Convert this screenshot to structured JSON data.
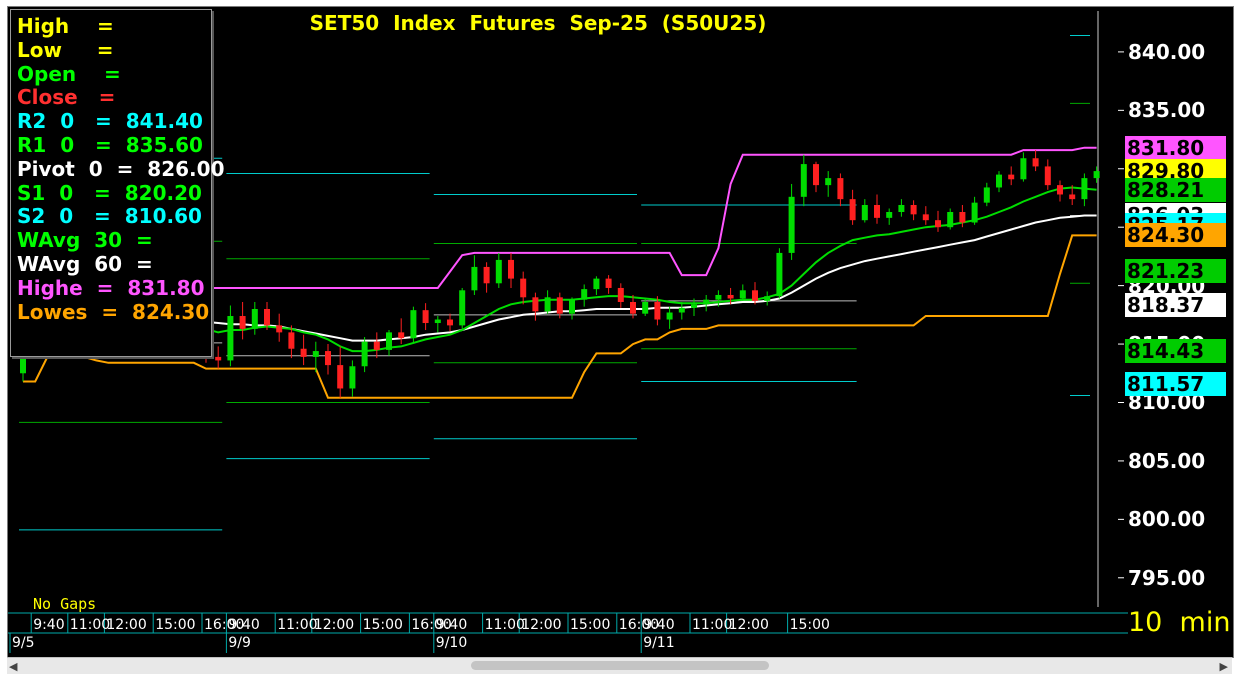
{
  "title": "SET50  Index  Futures  Sep-25  (S50U25)",
  "legend": [
    {
      "label": "High    =",
      "color": "#ffff00"
    },
    {
      "label": "Low     =",
      "color": "#ffff00"
    },
    {
      "label": "Open    =",
      "color": "#00ff00"
    },
    {
      "label": "Close   =",
      "color": "#ff3030"
    },
    {
      "label": "R2  0   =  841.40",
      "color": "#00ffff"
    },
    {
      "label": "R1  0   =  835.60",
      "color": "#00ff00"
    },
    {
      "label": "Pivot  0  =  826.00",
      "color": "#ffffff"
    },
    {
      "label": "S1  0   =  820.20",
      "color": "#00ff00"
    },
    {
      "label": "S2  0   =  810.60",
      "color": "#00ffff"
    },
    {
      "label": "WAvg  30  =",
      "color": "#00ff00"
    },
    {
      "label": "WAvg  60  =",
      "color": "#ffffff"
    },
    {
      "label": "Highe  =  831.80",
      "color": "#ff55ff"
    },
    {
      "label": "Lowes  =  824.30",
      "color": "#ffa500"
    }
  ],
  "no_gaps_label": "No Gaps",
  "interval_label": "10  min",
  "value_tags": [
    {
      "value": "831.80",
      "bg": "#ff55ff",
      "fg": "#000000"
    },
    {
      "value": "829.80",
      "bg": "#ffff00",
      "fg": "#000000"
    },
    {
      "value": "828.21",
      "bg": "#00cc00",
      "fg": "#000000"
    },
    {
      "value": "826.03",
      "bg": "#ffffff",
      "fg": "#000000"
    },
    {
      "value": "825.17",
      "bg": "#00ffff",
      "fg": "#000000"
    },
    {
      "value": "824.30",
      "bg": "#ffa500",
      "fg": "#000000"
    },
    {
      "value": "821.23",
      "bg": "#00cc00",
      "fg": "#000000"
    },
    {
      "value": "818.37",
      "bg": "#ffffff",
      "fg": "#000000"
    },
    {
      "value": "814.43",
      "bg": "#00cc00",
      "fg": "#000000"
    },
    {
      "value": "811.57",
      "bg": "#00ffff",
      "fg": "#000000"
    }
  ],
  "colors": {
    "background": "#000000",
    "bull": "#00dd00",
    "bear": "#ff2020",
    "highest": "#ff55ff",
    "lowest": "#ffa500",
    "wavg30": "#00dd00",
    "wavg60": "#ffffff",
    "pivot_r2": "#00cccc",
    "pivot_r1": "#00aa00",
    "pivot_s1": "#00aa00",
    "pivot_s2": "#00cccc",
    "time_axis": "#00aaaa"
  },
  "chart_data": {
    "type": "candlestick",
    "title": "SET50  Index  Futures  Sep-25  (S50U25)",
    "interval": "10  min",
    "ylim": [
      792.5,
      843.5
    ],
    "yticks": [
      "840.00",
      "835.00",
      "830.00",
      "825.00",
      "820.00",
      "815.00",
      "810.00",
      "805.00",
      "800.00",
      "795.00"
    ],
    "time_ticks": [
      {
        "bar": 1,
        "label": "9:40"
      },
      {
        "bar": 4,
        "label": "11:00"
      },
      {
        "bar": 7,
        "label": "12:00"
      },
      {
        "bar": 11,
        "label": "15:00"
      },
      {
        "bar": 15,
        "label": "16:00"
      },
      {
        "bar": 17,
        "label": "9:40"
      },
      {
        "bar": 21,
        "label": "11:00"
      },
      {
        "bar": 24,
        "label": "12:00"
      },
      {
        "bar": 28,
        "label": "15:00"
      },
      {
        "bar": 32,
        "label": "16:00"
      },
      {
        "bar": 34,
        "label": "9:40"
      },
      {
        "bar": 38,
        "label": "11:00"
      },
      {
        "bar": 41,
        "label": "12:00"
      },
      {
        "bar": 45,
        "label": "15:00"
      },
      {
        "bar": 49,
        "label": "16:00"
      },
      {
        "bar": 51,
        "label": "9:40"
      },
      {
        "bar": 55,
        "label": "11:00"
      },
      {
        "bar": 58,
        "label": "12:00"
      },
      {
        "bar": 63,
        "label": "15:00"
      }
    ],
    "dates": [
      {
        "bar": 0,
        "label": "9/5"
      },
      {
        "bar": 17,
        "label": "9/9"
      },
      {
        "bar": 34,
        "label": "9/10"
      },
      {
        "bar": 51,
        "label": "9/11"
      }
    ],
    "candles": [
      [
        812.5,
        815.2,
        811.8,
        814.6
      ],
      [
        814.6,
        816.0,
        813.9,
        815.4
      ],
      [
        815.4,
        817.0,
        814.8,
        816.2
      ],
      [
        816.2,
        818.6,
        815.6,
        818.0
      ],
      [
        818.0,
        818.8,
        816.5,
        817.1
      ],
      [
        817.1,
        818.0,
        815.8,
        816.4
      ],
      [
        816.4,
        817.8,
        815.2,
        817.2
      ],
      [
        817.2,
        818.5,
        816.3,
        817.6
      ],
      [
        817.6,
        818.4,
        816.4,
        816.9
      ],
      [
        816.9,
        817.7,
        815.3,
        815.8
      ],
      [
        815.8,
        817.0,
        814.6,
        816.5
      ],
      [
        816.5,
        817.8,
        815.8,
        817.1
      ],
      [
        817.1,
        817.5,
        815.4,
        815.8
      ],
      [
        815.8,
        816.6,
        814.2,
        814.8
      ],
      [
        814.8,
        816.2,
        814.0,
        815.6
      ],
      [
        815.6,
        816.0,
        813.4,
        813.9
      ],
      [
        813.9,
        814.8,
        812.9,
        813.6
      ],
      [
        813.6,
        818.3,
        813.1,
        817.4
      ],
      [
        817.4,
        818.6,
        815.4,
        816.3
      ],
      [
        816.3,
        818.6,
        815.8,
        818.0
      ],
      [
        818.0,
        818.6,
        816.2,
        816.6
      ],
      [
        816.6,
        817.6,
        815.2,
        816.0
      ],
      [
        816.0,
        816.6,
        813.8,
        814.6
      ],
      [
        814.6,
        815.8,
        813.2,
        813.9
      ],
      [
        813.9,
        815.2,
        812.6,
        814.4
      ],
      [
        814.4,
        815.0,
        812.4,
        813.2
      ],
      [
        813.2,
        814.8,
        810.4,
        811.2
      ],
      [
        811.2,
        813.6,
        810.5,
        813.1
      ],
      [
        813.1,
        815.6,
        812.6,
        815.2
      ],
      [
        815.2,
        816.0,
        813.8,
        814.5
      ],
      [
        814.5,
        816.2,
        814.0,
        816.0
      ],
      [
        816.0,
        817.2,
        815.0,
        815.5
      ],
      [
        815.5,
        818.2,
        815.1,
        817.9
      ],
      [
        817.9,
        818.5,
        816.2,
        816.8
      ],
      [
        816.8,
        817.4,
        816.0,
        817.1
      ],
      [
        817.1,
        817.6,
        816.1,
        816.6
      ],
      [
        816.6,
        819.8,
        816.2,
        819.6
      ],
      [
        819.6,
        822.6,
        819.2,
        821.6
      ],
      [
        821.6,
        822.0,
        819.4,
        820.2
      ],
      [
        820.2,
        822.8,
        819.8,
        822.2
      ],
      [
        822.2,
        822.8,
        819.8,
        820.6
      ],
      [
        820.6,
        821.2,
        818.4,
        819.0
      ],
      [
        819.0,
        819.4,
        817.0,
        817.8
      ],
      [
        817.8,
        819.6,
        817.6,
        819.0
      ],
      [
        819.0,
        819.4,
        817.2,
        817.6
      ],
      [
        817.6,
        819.0,
        817.1,
        818.8
      ],
      [
        818.8,
        820.1,
        818.2,
        819.7
      ],
      [
        819.7,
        820.8,
        819.2,
        820.6
      ],
      [
        820.6,
        820.9,
        819.3,
        819.8
      ],
      [
        819.8,
        820.2,
        818.1,
        818.6
      ],
      [
        818.6,
        819.2,
        817.2,
        817.6
      ],
      [
        817.6,
        818.9,
        817.4,
        818.6
      ],
      [
        818.6,
        819.1,
        816.6,
        817.1
      ],
      [
        817.1,
        818.2,
        816.3,
        817.7
      ],
      [
        817.7,
        818.6,
        817.1,
        818.1
      ],
      [
        818.1,
        818.9,
        817.4,
        818.4
      ],
      [
        818.4,
        819.2,
        817.8,
        818.8
      ],
      [
        818.8,
        819.6,
        818.2,
        819.2
      ],
      [
        819.2,
        819.8,
        818.4,
        818.9
      ],
      [
        818.9,
        820.1,
        818.7,
        819.6
      ],
      [
        819.6,
        820.3,
        818.4,
        818.7
      ],
      [
        818.7,
        819.5,
        818.3,
        819.1
      ],
      [
        819.1,
        823.2,
        818.9,
        822.8
      ],
      [
        822.8,
        828.7,
        822.2,
        827.6
      ],
      [
        827.6,
        831.2,
        826.8,
        830.4
      ],
      [
        830.4,
        830.6,
        828.0,
        828.6
      ],
      [
        828.6,
        829.8,
        827.6,
        829.2
      ],
      [
        829.2,
        829.6,
        826.8,
        827.4
      ],
      [
        827.4,
        828.2,
        825.2,
        825.6
      ],
      [
        825.6,
        827.4,
        825.4,
        826.9
      ],
      [
        826.9,
        827.8,
        825.3,
        825.8
      ],
      [
        825.8,
        826.6,
        825.2,
        826.3
      ],
      [
        826.3,
        827.4,
        825.9,
        826.9
      ],
      [
        826.9,
        827.3,
        825.6,
        826.1
      ],
      [
        826.1,
        826.8,
        825.2,
        825.6
      ],
      [
        825.6,
        826.4,
        824.6,
        825.0
      ],
      [
        825.0,
        826.6,
        824.8,
        826.3
      ],
      [
        826.3,
        826.9,
        825.0,
        825.4
      ],
      [
        825.4,
        827.6,
        825.2,
        827.1
      ],
      [
        827.1,
        828.8,
        826.8,
        828.4
      ],
      [
        828.4,
        829.8,
        828.0,
        829.5
      ],
      [
        829.5,
        830.2,
        828.6,
        829.1
      ],
      [
        829.1,
        831.4,
        828.9,
        830.9
      ],
      [
        830.9,
        831.6,
        829.8,
        830.2
      ],
      [
        830.2,
        830.8,
        828.2,
        828.6
      ],
      [
        828.6,
        829.0,
        827.2,
        827.8
      ],
      [
        827.8,
        828.6,
        826.9,
        827.4
      ],
      [
        827.4,
        829.6,
        826.8,
        829.2
      ],
      [
        829.2,
        830.2,
        828.8,
        829.8
      ]
    ],
    "highest": {
      "values": [
        824.0,
        824.0,
        824.0,
        824.0,
        824.0,
        824.0,
        824.0,
        824.0,
        824.0,
        824.0,
        824.0,
        824.0,
        822.8,
        820.4,
        819.8,
        819.8,
        819.8,
        819.8,
        819.8,
        819.8,
        819.8,
        819.8,
        819.8,
        819.8,
        819.8,
        819.8,
        819.8,
        819.8,
        819.8,
        819.8,
        819.8,
        819.8,
        819.8,
        819.8,
        819.8,
        821.2,
        822.6,
        822.8,
        822.8,
        822.8,
        822.8,
        822.8,
        822.8,
        822.8,
        822.8,
        822.8,
        822.8,
        822.8,
        822.8,
        822.8,
        822.8,
        822.8,
        822.8,
        822.8,
        820.9,
        820.9,
        820.9,
        823.2,
        828.7,
        831.2,
        831.2,
        831.2,
        831.2,
        831.2,
        831.2,
        831.2,
        831.2,
        831.2,
        831.2,
        831.2,
        831.2,
        831.2,
        831.2,
        831.2,
        831.2,
        831.2,
        831.2,
        831.2,
        831.2,
        831.2,
        831.2,
        831.2,
        831.6,
        831.6,
        831.6,
        831.6,
        831.6,
        831.8,
        831.8
      ]
    },
    "lowest": {
      "values": [
        811.8,
        811.8,
        813.9,
        813.9,
        813.9,
        813.9,
        813.6,
        813.4,
        813.4,
        813.4,
        813.4,
        813.4,
        813.4,
        813.4,
        813.4,
        812.9,
        812.9,
        812.9,
        812.9,
        812.9,
        812.9,
        812.9,
        812.9,
        812.9,
        812.9,
        810.4,
        810.4,
        810.4,
        810.4,
        810.4,
        810.4,
        810.4,
        810.4,
        810.4,
        810.4,
        810.4,
        810.4,
        810.4,
        810.4,
        810.4,
        810.4,
        810.4,
        810.4,
        810.4,
        810.4,
        810.4,
        812.6,
        814.2,
        814.2,
        814.2,
        815.0,
        815.4,
        815.4,
        816.0,
        816.3,
        816.3,
        816.3,
        816.6,
        816.6,
        816.6,
        816.6,
        816.6,
        816.6,
        816.6,
        816.6,
        816.6,
        816.6,
        816.6,
        816.6,
        816.6,
        816.6,
        816.6,
        816.6,
        816.6,
        817.4,
        817.4,
        817.4,
        817.4,
        817.4,
        817.4,
        817.4,
        817.4,
        817.4,
        817.4,
        817.4,
        821.0,
        824.3,
        824.3,
        824.3
      ]
    },
    "wavg30": {
      "values": [
        null,
        null,
        null,
        null,
        null,
        null,
        null,
        null,
        null,
        null,
        null,
        817.0,
        816.9,
        816.6,
        816.5,
        816.3,
        816.0,
        816.2,
        816.2,
        816.4,
        816.5,
        816.4,
        816.3,
        816.0,
        815.8,
        815.4,
        814.8,
        814.4,
        814.4,
        814.5,
        814.7,
        814.8,
        815.1,
        815.4,
        815.6,
        815.8,
        816.2,
        816.8,
        817.4,
        818.0,
        818.4,
        818.6,
        818.7,
        818.8,
        818.8,
        818.8,
        818.9,
        819.0,
        819.1,
        819.1,
        819.0,
        818.9,
        818.8,
        818.6,
        818.5,
        818.5,
        818.5,
        818.6,
        818.7,
        818.8,
        818.8,
        819.0,
        819.3,
        820.0,
        821.0,
        822.0,
        822.8,
        823.4,
        823.9,
        824.1,
        824.3,
        824.4,
        824.6,
        824.8,
        825.0,
        825.1,
        825.2,
        825.4,
        825.6,
        825.9,
        826.3,
        826.7,
        827.2,
        827.6,
        828.0,
        828.3,
        828.4,
        828.3,
        828.2
      ]
    },
    "wavg60": {
      "values": [
        null,
        null,
        null,
        null,
        null,
        null,
        null,
        null,
        null,
        null,
        null,
        817.4,
        817.3,
        817.2,
        817.0,
        816.9,
        816.8,
        816.7,
        816.7,
        816.6,
        816.6,
        816.5,
        816.3,
        816.1,
        815.9,
        815.7,
        815.5,
        815.3,
        815.3,
        815.3,
        815.4,
        815.5,
        815.6,
        815.8,
        815.9,
        816.0,
        816.2,
        816.5,
        816.8,
        817.1,
        817.3,
        817.5,
        817.6,
        817.7,
        817.8,
        817.8,
        817.9,
        818.0,
        818.0,
        818.0,
        818.0,
        818.0,
        818.1,
        818.1,
        818.1,
        818.2,
        818.3,
        818.4,
        818.5,
        818.6,
        818.6,
        818.7,
        818.9,
        819.4,
        820.0,
        820.6,
        821.1,
        821.5,
        821.8,
        822.1,
        822.3,
        822.5,
        822.7,
        822.9,
        823.1,
        823.3,
        823.5,
        823.7,
        823.9,
        824.2,
        824.5,
        824.8,
        825.1,
        825.4,
        825.6,
        825.8,
        825.9,
        826.0,
        826.0
      ]
    },
    "pivots": [
      {
        "name": "R2",
        "start": 0,
        "end": 16,
        "value": 830.9
      },
      {
        "name": "R1",
        "start": 0,
        "end": 16,
        "value": 823.8
      },
      {
        "name": "Pivot",
        "start": 0,
        "end": 16,
        "value": 815.1
      },
      {
        "name": "S1",
        "start": 0,
        "end": 16,
        "value": 808.3
      },
      {
        "name": "S2",
        "start": 0,
        "end": 16,
        "value": 799.1
      },
      {
        "name": "R2",
        "start": 17,
        "end": 33,
        "value": 829.6
      },
      {
        "name": "R1",
        "start": 17,
        "end": 33,
        "value": 822.3
      },
      {
        "name": "Pivot",
        "start": 17,
        "end": 33,
        "value": 814.0
      },
      {
        "name": "S1",
        "start": 17,
        "end": 33,
        "value": 810.0
      },
      {
        "name": "S2",
        "start": 17,
        "end": 33,
        "value": 805.2
      },
      {
        "name": "R2",
        "start": 34,
        "end": 50,
        "value": 827.8
      },
      {
        "name": "R1",
        "start": 34,
        "end": 50,
        "value": 823.6
      },
      {
        "name": "Pivot",
        "start": 34,
        "end": 50,
        "value": 817.5
      },
      {
        "name": "S1",
        "start": 34,
        "end": 50,
        "value": 813.4
      },
      {
        "name": "S2",
        "start": 34,
        "end": 50,
        "value": 806.9
      },
      {
        "name": "R2",
        "start": 51,
        "end": 68,
        "value": 826.9
      },
      {
        "name": "R1",
        "start": 51,
        "end": 68,
        "value": 823.6
      },
      {
        "name": "Pivot",
        "start": 51,
        "end": 68,
        "value": 818.7
      },
      {
        "name": "S1",
        "start": 51,
        "end": 68,
        "value": 814.6
      },
      {
        "name": "S2",
        "start": 51,
        "end": 68,
        "value": 811.8
      },
      {
        "name": "R2",
        "start": 69,
        "end": 68,
        "value": 841.4
      },
      {
        "name": "R1",
        "start": 69,
        "end": 68,
        "value": 835.6
      },
      {
        "name": "Pivot",
        "start": 69,
        "end": 68,
        "value": 826.0
      },
      {
        "name": "S1",
        "start": 69,
        "end": 68,
        "value": 820.2
      },
      {
        "name": "S2",
        "start": 69,
        "end": 68,
        "value": 810.6
      }
    ]
  }
}
